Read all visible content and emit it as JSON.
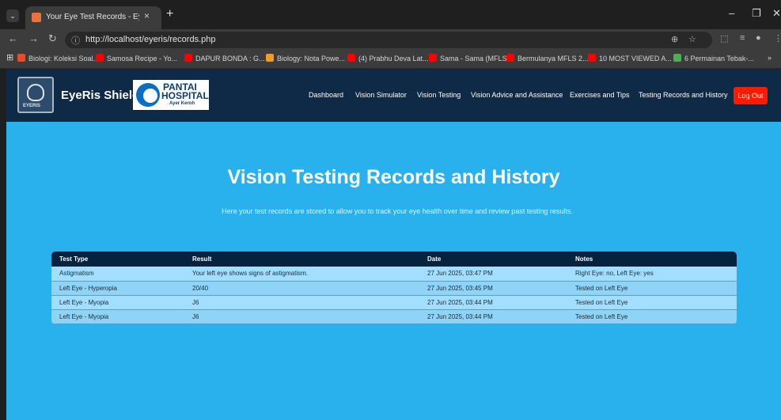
{
  "browser": {
    "tab_title": "Your Eye Test Records - EyeRis",
    "tab_close": "×",
    "new_tab": "+",
    "url": "http://localhost/eyeris/records.php",
    "bookmarks": [
      {
        "label": "Biologi: Koleksi Soal...",
        "color": "#e94b2b"
      },
      {
        "label": "Samosa Recipe - Yo...",
        "color": "#ff0000"
      },
      {
        "label": "DAPUR BONDA : G...",
        "color": "#ff0000"
      },
      {
        "label": "Biology: Nota Powe...",
        "color": "#f09a2a"
      },
      {
        "label": "(4) Prabhu Deva Lat...",
        "color": "#ff0000"
      },
      {
        "label": "Sama - Sama (MFLS...",
        "color": "#ff0000"
      },
      {
        "label": "Bermulanya MFLS 2...",
        "color": "#ff0000"
      },
      {
        "label": "10 MOST VIEWED A...",
        "color": "#ff0000"
      },
      {
        "label": "6 Permainan Tebak-...",
        "color": "#4caf50"
      }
    ]
  },
  "header": {
    "brand": "EyeRis Shield",
    "logo_text": "EYERIS",
    "hospital_line1": "PANTAI",
    "hospital_line2": "HOSPITAL",
    "hospital_line3": "Ayer Keroh",
    "nav": [
      "Dashboard",
      "Vision Simulator",
      "Vision Testing",
      "Vision Advice and Assistance",
      "Exercises and Tips",
      "Testing Records and History"
    ],
    "logout": "Log Out"
  },
  "main": {
    "title": "Vision Testing Records and History",
    "description": "Here your test records are stored to allow you to track your eye health over time and review past testing results.",
    "table": {
      "headers": [
        "Test Type",
        "Result",
        "Date",
        "Notes"
      ],
      "rows": [
        [
          "Astigmatism",
          "Your left eye shows signs of astigmatism.",
          "27 Jun 2025, 03:47 PM",
          "Right Eye: no, Left Eye: yes"
        ],
        [
          "Left Eye - Hyperopia",
          "20/40",
          "27 Jun 2025, 03:45 PM",
          "Tested on Left Eye"
        ],
        [
          "Left Eye - Myopia",
          "J6",
          "27 Jun 2025, 03:44 PM",
          "Tested on Left Eye"
        ],
        [
          "Left Eye - Myopia",
          "J6",
          "27 Jun 2025, 03:44 PM",
          "Tested on Left Eye"
        ]
      ]
    }
  }
}
